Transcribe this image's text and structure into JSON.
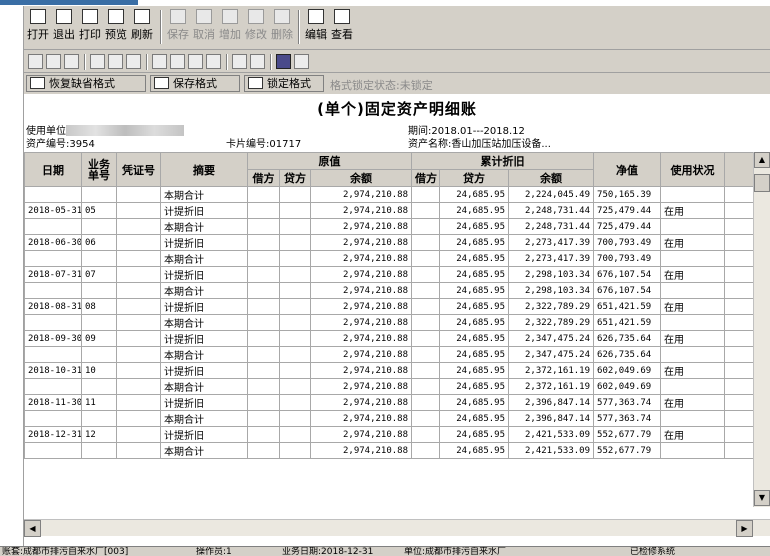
{
  "toolbar": {
    "buttons": [
      {
        "label": "打开",
        "icon": "folder-open-icon",
        "enabled": true
      },
      {
        "label": "退出",
        "icon": "exit-icon",
        "enabled": true
      },
      {
        "label": "打印",
        "icon": "printer-icon",
        "enabled": true
      },
      {
        "label": "预览",
        "icon": "preview-icon",
        "enabled": true
      },
      {
        "label": "刷新",
        "icon": "refresh-icon",
        "enabled": true
      },
      {
        "label": "保存",
        "icon": "save-icon",
        "enabled": false
      },
      {
        "label": "取消",
        "icon": "cancel-icon",
        "enabled": false
      },
      {
        "label": "增加",
        "icon": "add-icon",
        "enabled": false
      },
      {
        "label": "修改",
        "icon": "edit-icon",
        "enabled": false
      },
      {
        "label": "删除",
        "icon": "delete-icon",
        "enabled": false
      },
      {
        "label": "编辑",
        "icon": "edit-doc-icon",
        "enabled": true
      },
      {
        "label": "查看",
        "icon": "view-doc-icon",
        "enabled": true
      }
    ]
  },
  "navbar": {
    "icons": [
      "filter-funnel-icon",
      "comment-icon",
      "copy-doc-icon",
      "cut-icon",
      "copy-icon",
      "paste-icon",
      "first-record-icon",
      "prev-record-icon",
      "next-record-icon",
      "last-record-icon",
      "filter-icon",
      "table-icon",
      "window-icon",
      "calculator-icon"
    ]
  },
  "formatbar": {
    "restore_label": "恢复缺省格式",
    "save_label": "保存格式",
    "lock_label": "锁定格式",
    "lock_status": "格式锁定状态:未锁定"
  },
  "report": {
    "title": "(单个)固定资产明细账",
    "unit_label": "使用单位",
    "asset_no": "资产编号:3954",
    "card_no": "卡片编号:01717",
    "period": "期间:2018.01---2018.12",
    "asset_name": "资产名称:香山加压站加压设备..."
  },
  "table": {
    "headers": {
      "date": "日期",
      "biz_no": "业务单号",
      "voucher": "凭证号",
      "summary": "摘要",
      "original": "原值",
      "debit": "借方",
      "credit": "贷方",
      "balance": "余额",
      "depreciation": "累计折旧",
      "net": "净值",
      "status": "使用状况"
    },
    "rows": [
      {
        "date": "",
        "no": "",
        "voucher": "",
        "summary": "本期合计",
        "o_debit": "",
        "o_credit": "",
        "o_balance": "2,974,210.88",
        "d_debit": "",
        "d_credit": "24,685.95",
        "d_balance": "2,224,045.49",
        "net": "750,165.39",
        "status": ""
      },
      {
        "date": "2018-05-31",
        "no": "05",
        "voucher": "",
        "summary": "计提折旧",
        "o_debit": "",
        "o_credit": "",
        "o_balance": "2,974,210.88",
        "d_debit": "",
        "d_credit": "24,685.95",
        "d_balance": "2,248,731.44",
        "net": "725,479.44",
        "status": "在用"
      },
      {
        "date": "",
        "no": "",
        "voucher": "",
        "summary": "本期合计",
        "o_debit": "",
        "o_credit": "",
        "o_balance": "2,974,210.88",
        "d_debit": "",
        "d_credit": "24,685.95",
        "d_balance": "2,248,731.44",
        "net": "725,479.44",
        "status": ""
      },
      {
        "date": "2018-06-30",
        "no": "06",
        "voucher": "",
        "summary": "计提折旧",
        "o_debit": "",
        "o_credit": "",
        "o_balance": "2,974,210.88",
        "d_debit": "",
        "d_credit": "24,685.95",
        "d_balance": "2,273,417.39",
        "net": "700,793.49",
        "status": "在用"
      },
      {
        "date": "",
        "no": "",
        "voucher": "",
        "summary": "本期合计",
        "o_debit": "",
        "o_credit": "",
        "o_balance": "2,974,210.88",
        "d_debit": "",
        "d_credit": "24,685.95",
        "d_balance": "2,273,417.39",
        "net": "700,793.49",
        "status": ""
      },
      {
        "date": "2018-07-31",
        "no": "07",
        "voucher": "",
        "summary": "计提折旧",
        "o_debit": "",
        "o_credit": "",
        "o_balance": "2,974,210.88",
        "d_debit": "",
        "d_credit": "24,685.95",
        "d_balance": "2,298,103.34",
        "net": "676,107.54",
        "status": "在用"
      },
      {
        "date": "",
        "no": "",
        "voucher": "",
        "summary": "本期合计",
        "o_debit": "",
        "o_credit": "",
        "o_balance": "2,974,210.88",
        "d_debit": "",
        "d_credit": "24,685.95",
        "d_balance": "2,298,103.34",
        "net": "676,107.54",
        "status": ""
      },
      {
        "date": "2018-08-31",
        "no": "08",
        "voucher": "",
        "summary": "计提折旧",
        "o_debit": "",
        "o_credit": "",
        "o_balance": "2,974,210.88",
        "d_debit": "",
        "d_credit": "24,685.95",
        "d_balance": "2,322,789.29",
        "net": "651,421.59",
        "status": "在用"
      },
      {
        "date": "",
        "no": "",
        "voucher": "",
        "summary": "本期合计",
        "o_debit": "",
        "o_credit": "",
        "o_balance": "2,974,210.88",
        "d_debit": "",
        "d_credit": "24,685.95",
        "d_balance": "2,322,789.29",
        "net": "651,421.59",
        "status": ""
      },
      {
        "date": "2018-09-30",
        "no": "09",
        "voucher": "",
        "summary": "计提折旧",
        "o_debit": "",
        "o_credit": "",
        "o_balance": "2,974,210.88",
        "d_debit": "",
        "d_credit": "24,685.95",
        "d_balance": "2,347,475.24",
        "net": "626,735.64",
        "status": "在用"
      },
      {
        "date": "",
        "no": "",
        "voucher": "",
        "summary": "本期合计",
        "o_debit": "",
        "o_credit": "",
        "o_balance": "2,974,210.88",
        "d_debit": "",
        "d_credit": "24,685.95",
        "d_balance": "2,347,475.24",
        "net": "626,735.64",
        "status": ""
      },
      {
        "date": "2018-10-31",
        "no": "10",
        "voucher": "",
        "summary": "计提折旧",
        "o_debit": "",
        "o_credit": "",
        "o_balance": "2,974,210.88",
        "d_debit": "",
        "d_credit": "24,685.95",
        "d_balance": "2,372,161.19",
        "net": "602,049.69",
        "status": "在用"
      },
      {
        "date": "",
        "no": "",
        "voucher": "",
        "summary": "本期合计",
        "o_debit": "",
        "o_credit": "",
        "o_balance": "2,974,210.88",
        "d_debit": "",
        "d_credit": "24,685.95",
        "d_balance": "2,372,161.19",
        "net": "602,049.69",
        "status": ""
      },
      {
        "date": "2018-11-30",
        "no": "11",
        "voucher": "",
        "summary": "计提折旧",
        "o_debit": "",
        "o_credit": "",
        "o_balance": "2,974,210.88",
        "d_debit": "",
        "d_credit": "24,685.95",
        "d_balance": "2,396,847.14",
        "net": "577,363.74",
        "status": "在用"
      },
      {
        "date": "",
        "no": "",
        "voucher": "",
        "summary": "本期合计",
        "o_debit": "",
        "o_credit": "",
        "o_balance": "2,974,210.88",
        "d_debit": "",
        "d_credit": "24,685.95",
        "d_balance": "2,396,847.14",
        "net": "577,363.74",
        "status": ""
      },
      {
        "date": "2018-12-31",
        "no": "12",
        "voucher": "",
        "summary": "计提折旧",
        "o_debit": "",
        "o_credit": "",
        "o_balance": "2,974,210.88",
        "d_debit": "",
        "d_credit": "24,685.95",
        "d_balance": "2,421,533.09",
        "net": "552,677.79",
        "status": "在用"
      },
      {
        "date": "",
        "no": "",
        "voucher": "",
        "summary": "本期合计",
        "o_debit": "",
        "o_credit": "",
        "o_balance": "2,974,210.88",
        "d_debit": "",
        "d_credit": "24,685.95",
        "d_balance": "2,421,533.09",
        "net": "552,677.79",
        "status": ""
      }
    ]
  },
  "statusbar": {
    "company": "账套:成都市排污自来水厂[003]",
    "operator": "操作员:1",
    "business_date": "业务日期:2018-12-31",
    "unit": "单位:成都市排污自来水厂",
    "extra": "已检修系统"
  }
}
